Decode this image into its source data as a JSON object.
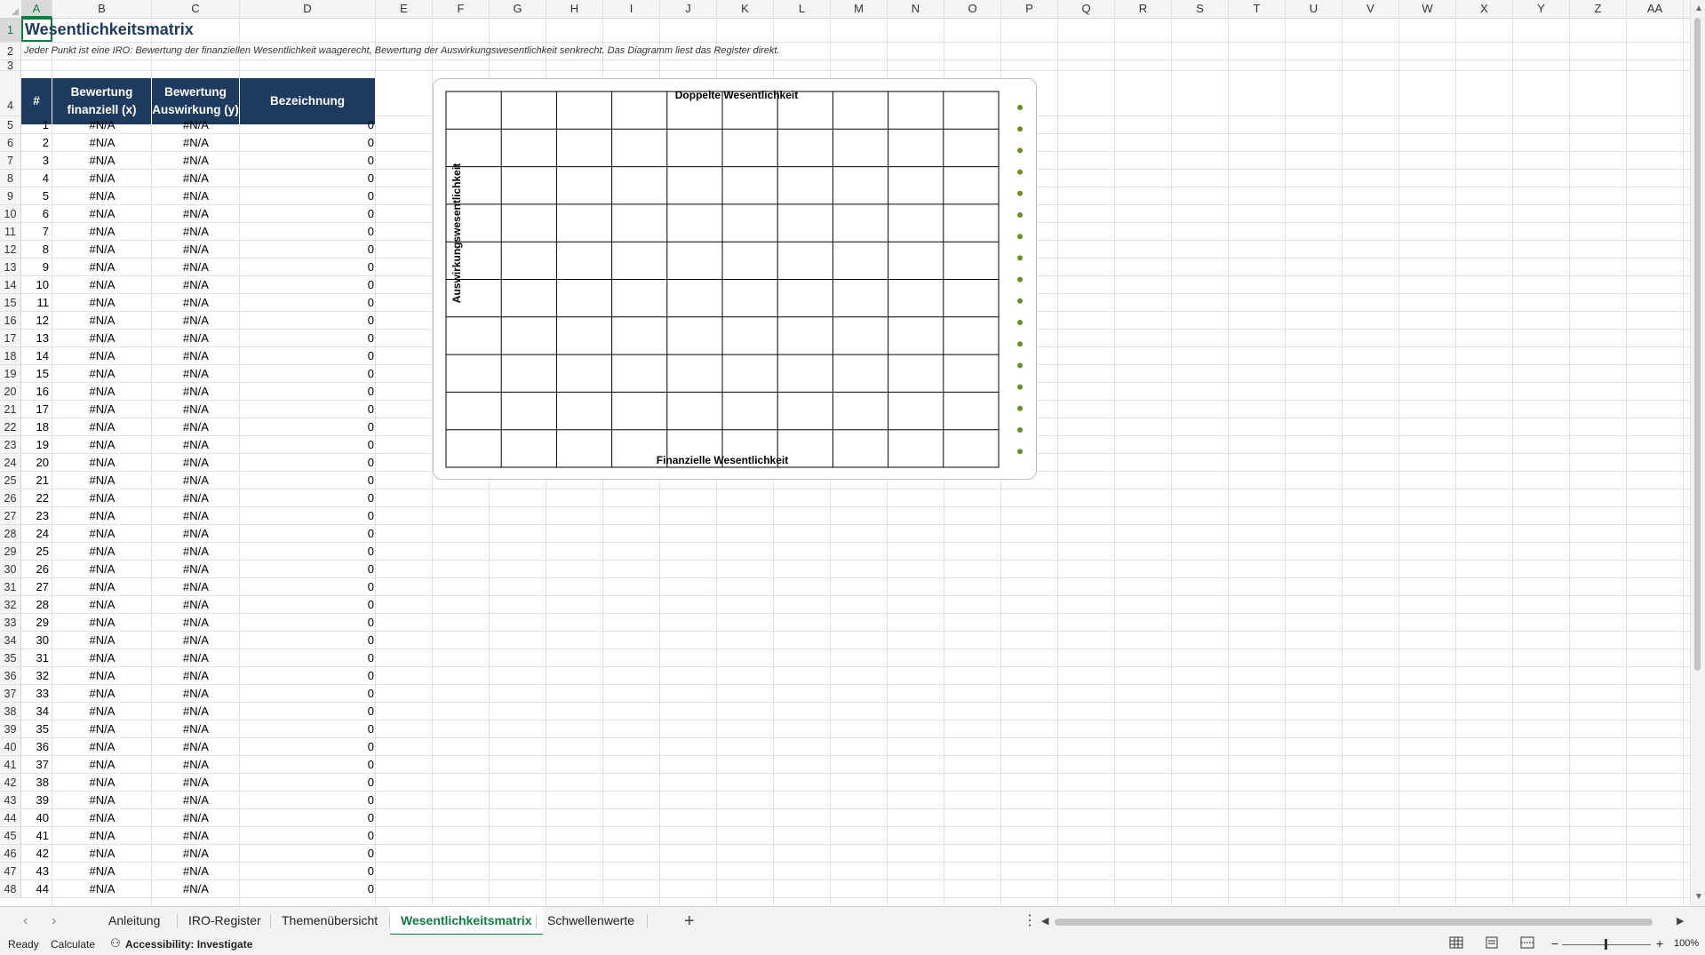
{
  "sheet": {
    "title": "Wesentlichkeitsmatrix",
    "subtitle": "Jeder Punkt ist eine IRO: Bewertung der finanziellen Wesentlichkeit waagerecht, Bewertung der Auswirkungswesentlichkeit senkrecht. Das Diagramm liest das Register direkt.",
    "columns": [
      "A",
      "B",
      "C",
      "D",
      "E",
      "F",
      "G",
      "H",
      "I",
      "J",
      "K",
      "L",
      "M",
      "N",
      "O",
      "P",
      "Q",
      "R",
      "S",
      "T",
      "U",
      "V",
      "W",
      "X",
      "Y",
      "Z",
      "AA"
    ],
    "rows": [
      "1",
      "2",
      "3",
      "4",
      "5",
      "6",
      "7",
      "8",
      "9",
      "10",
      "11",
      "12",
      "13",
      "14",
      "15",
      "16",
      "17",
      "18",
      "19",
      "20",
      "21",
      "22",
      "23",
      "24",
      "25",
      "26",
      "27",
      "28",
      "29",
      "30",
      "31",
      "32",
      "33",
      "34",
      "35",
      "36",
      "37",
      "38",
      "39",
      "40",
      "41",
      "42",
      "43",
      "44",
      "45",
      "46",
      "47",
      "48"
    ],
    "table": {
      "headers": [
        "#",
        "Bewertung finanziell (x)",
        "Bewertung Auswirkung (y)",
        "Bezeichnung"
      ],
      "rows": [
        [
          "1",
          "#N/A",
          "#N/A",
          "0"
        ],
        [
          "2",
          "#N/A",
          "#N/A",
          "0"
        ],
        [
          "3",
          "#N/A",
          "#N/A",
          "0"
        ],
        [
          "4",
          "#N/A",
          "#N/A",
          "0"
        ],
        [
          "5",
          "#N/A",
          "#N/A",
          "0"
        ],
        [
          "6",
          "#N/A",
          "#N/A",
          "0"
        ],
        [
          "7",
          "#N/A",
          "#N/A",
          "0"
        ],
        [
          "8",
          "#N/A",
          "#N/A",
          "0"
        ],
        [
          "9",
          "#N/A",
          "#N/A",
          "0"
        ],
        [
          "10",
          "#N/A",
          "#N/A",
          "0"
        ],
        [
          "11",
          "#N/A",
          "#N/A",
          "0"
        ],
        [
          "12",
          "#N/A",
          "#N/A",
          "0"
        ],
        [
          "13",
          "#N/A",
          "#N/A",
          "0"
        ],
        [
          "14",
          "#N/A",
          "#N/A",
          "0"
        ],
        [
          "15",
          "#N/A",
          "#N/A",
          "0"
        ],
        [
          "16",
          "#N/A",
          "#N/A",
          "0"
        ],
        [
          "17",
          "#N/A",
          "#N/A",
          "0"
        ],
        [
          "18",
          "#N/A",
          "#N/A",
          "0"
        ],
        [
          "19",
          "#N/A",
          "#N/A",
          "0"
        ],
        [
          "20",
          "#N/A",
          "#N/A",
          "0"
        ],
        [
          "21",
          "#N/A",
          "#N/A",
          "0"
        ],
        [
          "22",
          "#N/A",
          "#N/A",
          "0"
        ],
        [
          "23",
          "#N/A",
          "#N/A",
          "0"
        ],
        [
          "24",
          "#N/A",
          "#N/A",
          "0"
        ],
        [
          "25",
          "#N/A",
          "#N/A",
          "0"
        ],
        [
          "26",
          "#N/A",
          "#N/A",
          "0"
        ],
        [
          "27",
          "#N/A",
          "#N/A",
          "0"
        ],
        [
          "28",
          "#N/A",
          "#N/A",
          "0"
        ],
        [
          "29",
          "#N/A",
          "#N/A",
          "0"
        ],
        [
          "30",
          "#N/A",
          "#N/A",
          "0"
        ],
        [
          "31",
          "#N/A",
          "#N/A",
          "0"
        ],
        [
          "32",
          "#N/A",
          "#N/A",
          "0"
        ],
        [
          "33",
          "#N/A",
          "#N/A",
          "0"
        ],
        [
          "34",
          "#N/A",
          "#N/A",
          "0"
        ],
        [
          "35",
          "#N/A",
          "#N/A",
          "0"
        ],
        [
          "36",
          "#N/A",
          "#N/A",
          "0"
        ],
        [
          "37",
          "#N/A",
          "#N/A",
          "0"
        ],
        [
          "38",
          "#N/A",
          "#N/A",
          "0"
        ],
        [
          "39",
          "#N/A",
          "#N/A",
          "0"
        ],
        [
          "40",
          "#N/A",
          "#N/A",
          "0"
        ],
        [
          "41",
          "#N/A",
          "#N/A",
          "0"
        ],
        [
          "42",
          "#N/A",
          "#N/A",
          "0"
        ],
        [
          "43",
          "#N/A",
          "#N/A",
          "0"
        ],
        [
          "44",
          "#N/A",
          "#N/A",
          "0"
        ]
      ]
    },
    "header_color": "#1f3a5f"
  },
  "chart_data": {
    "type": "scatter",
    "title": "Doppelte Wesentlichkeit",
    "xlabel": "Finanzielle Wesentlichkeit",
    "ylabel": "Auswirkungswesentlichkeit",
    "grid": true,
    "legend": "right",
    "legend_markers": 17,
    "marker_color": "#6b8e23",
    "series": []
  },
  "tabs": {
    "items": [
      "Anleitung",
      "IRO-Register",
      "Themenübersicht",
      "Wesentlichkeitsmatrix",
      "Schwellenwerte"
    ],
    "active": "Wesentlichkeitsmatrix",
    "add_label": "+",
    "more_label": "⋮",
    "prev_label": "‹",
    "next_label": "›"
  },
  "status": {
    "ready": "Ready",
    "calculate": "Calculate",
    "accessibility": "Accessibility: Investigate",
    "zoom": "100%",
    "zoom_minus": "−",
    "zoom_plus": "+"
  },
  "accent_color": "#107c41"
}
